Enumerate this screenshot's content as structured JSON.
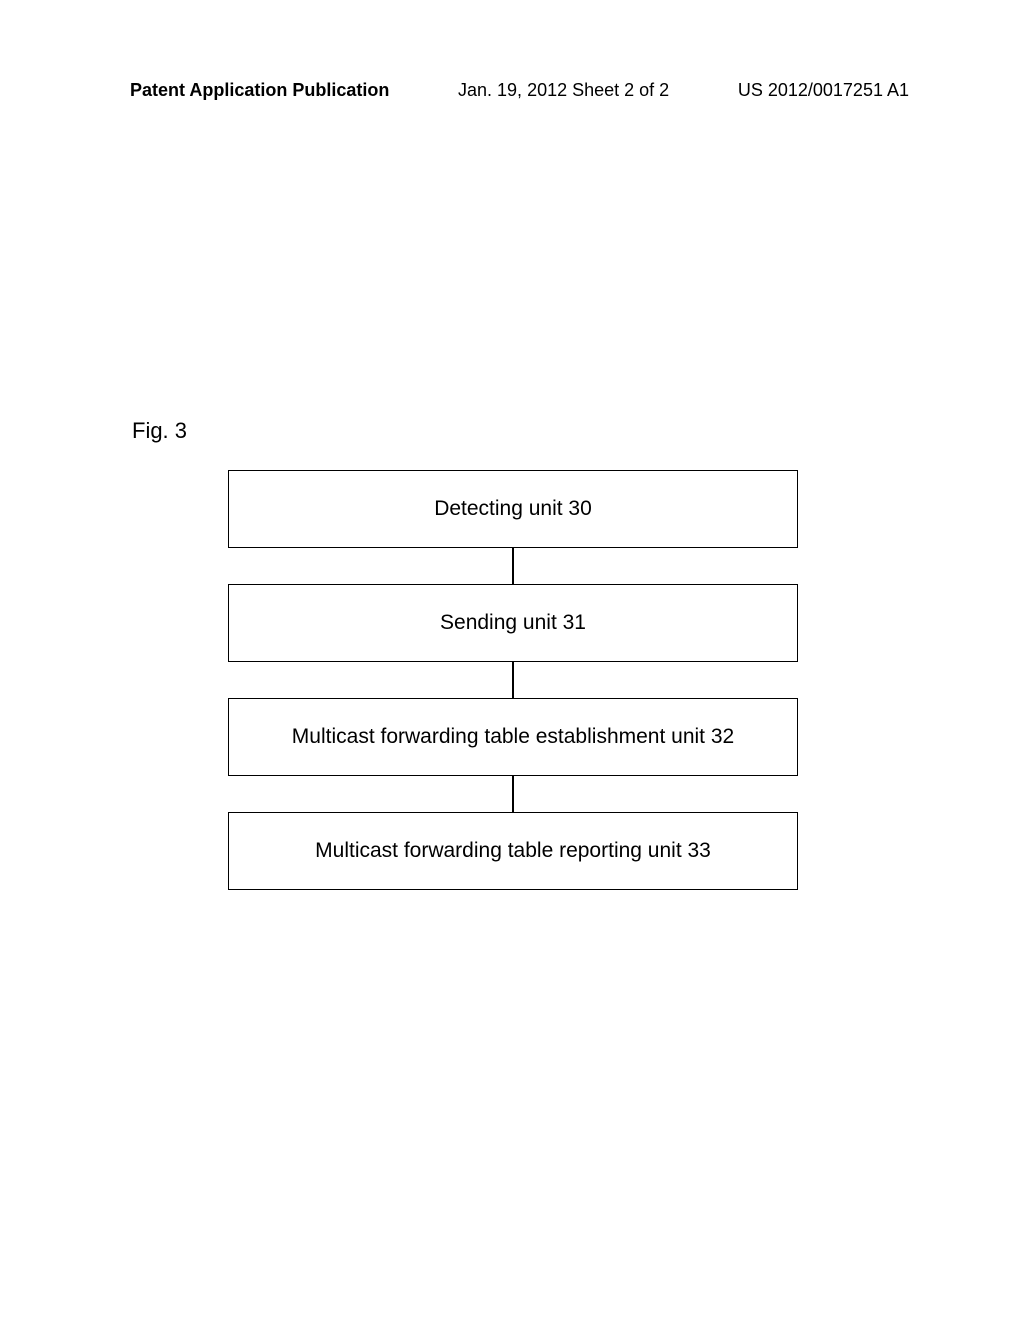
{
  "header": {
    "left": "Patent Application Publication",
    "center": "Jan. 19, 2012  Sheet 2 of 2",
    "right": "US 2012/0017251 A1"
  },
  "figure_label": "Fig. 3",
  "boxes": {
    "b0": "Detecting unit 30",
    "b1": "Sending unit 31",
    "b2": "Multicast forwarding table establishment unit 32",
    "b3": "Multicast forwarding table reporting unit 33"
  }
}
